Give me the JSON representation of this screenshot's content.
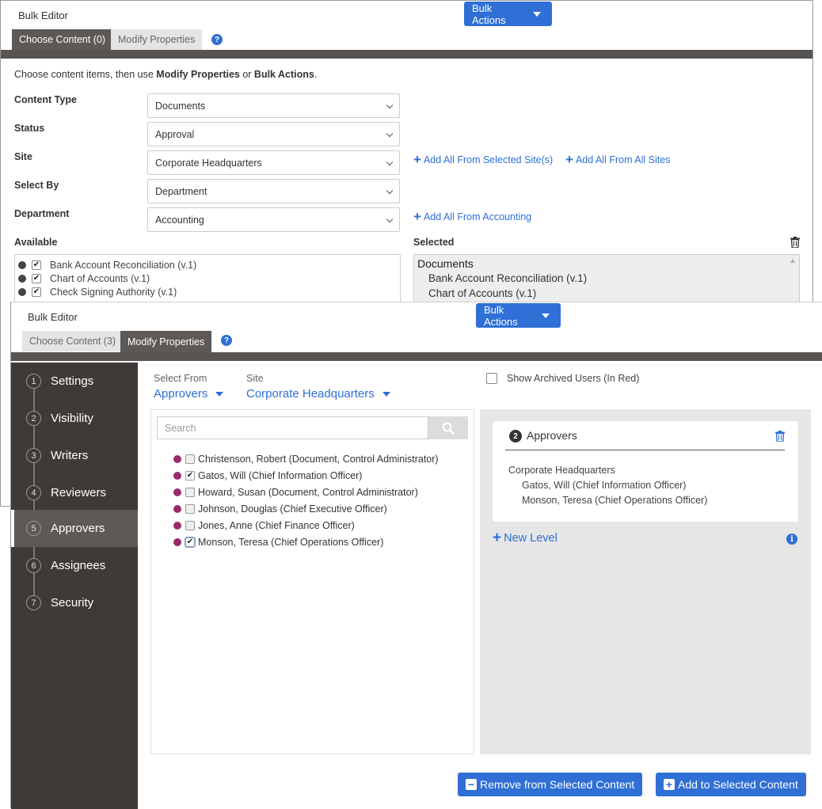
{
  "back_window": {
    "title": "Bulk Editor",
    "bulk_actions_label": "Bulk Actions",
    "tabs": [
      {
        "label": "Choose Content (0)",
        "active": true
      },
      {
        "label": "Modify Properties",
        "active": false
      }
    ],
    "intro": {
      "prefix": "Choose content items, then use ",
      "bold1": "Modify Properties",
      "mid": " or ",
      "bold2": "Bulk Actions",
      "suffix": "."
    },
    "fields": [
      {
        "label": "Content Type",
        "value": "Documents"
      },
      {
        "label": "Status",
        "value": "Approval"
      },
      {
        "label": "Site",
        "value": "Corporate Headquarters"
      },
      {
        "label": "Select By",
        "value": "Department"
      },
      {
        "label": "Department",
        "value": "Accounting"
      }
    ],
    "links": {
      "add_selected_sites": "Add All From Selected Site(s)",
      "add_all_sites": "Add All From All Sites",
      "add_from_accounting": "Add All From Accounting"
    },
    "available_label": "Available",
    "selected_label": "Selected",
    "available_items": [
      {
        "label": "Bank Account Reconciliation (v.1)",
        "checked": true
      },
      {
        "label": "Chart of Accounts (v.1)",
        "checked": true
      },
      {
        "label": "Check Signing Authority (v.1)",
        "checked": true
      }
    ],
    "selected_group": "Documents",
    "selected_items": [
      "Bank Account Reconciliation (v.1)",
      "Chart of Accounts (v.1)"
    ]
  },
  "front_window": {
    "title": "Bulk Editor",
    "bulk_actions_label": "Bulk Actions",
    "tabs": [
      {
        "label": "Choose Content (3)",
        "active": false
      },
      {
        "label": "Modify Properties",
        "active": true
      }
    ],
    "steps": [
      {
        "num": "1",
        "label": "Settings"
      },
      {
        "num": "2",
        "label": "Visibility"
      },
      {
        "num": "3",
        "label": "Writers"
      },
      {
        "num": "4",
        "label": "Reviewers"
      },
      {
        "num": "5",
        "label": "Approvers"
      },
      {
        "num": "6",
        "label": "Assignees"
      },
      {
        "num": "7",
        "label": "Security"
      }
    ],
    "active_step": "Approvers",
    "select_from_label": "Select From",
    "select_from_value": "Approvers",
    "site_label": "Site",
    "site_value": "Corporate Headquarters",
    "show_archived_label": "Show Archived Users (In Red)",
    "search_placeholder": "Search",
    "users": [
      {
        "label": "Christenson, Robert (Document, Control Administrator)",
        "checked": false
      },
      {
        "label": "Gatos, Will (Chief Information Officer)",
        "checked": true
      },
      {
        "label": "Howard, Susan (Document, Control Administrator)",
        "checked": false
      },
      {
        "label": "Johnson, Douglas (Chief Executive Officer)",
        "checked": false
      },
      {
        "label": "Jones, Anne (Chief Finance Officer)",
        "checked": false
      },
      {
        "label": "Monson, Teresa (Chief Operations Officer)",
        "checked": true
      }
    ],
    "approvers_card": {
      "level": "2",
      "title": "Approvers",
      "site": "Corporate Headquarters",
      "items": [
        "Gatos, Will (Chief Information Officer)",
        "Monson, Teresa (Chief Operations Officer)"
      ]
    },
    "new_level_label": "New Level",
    "remove_button": "Remove from Selected Content",
    "add_button": "Add to Selected Content"
  },
  "colors": {
    "accent": "#2f6fd6",
    "sidebar": "#3f3a38",
    "user_dot": "#9b2a6a"
  }
}
